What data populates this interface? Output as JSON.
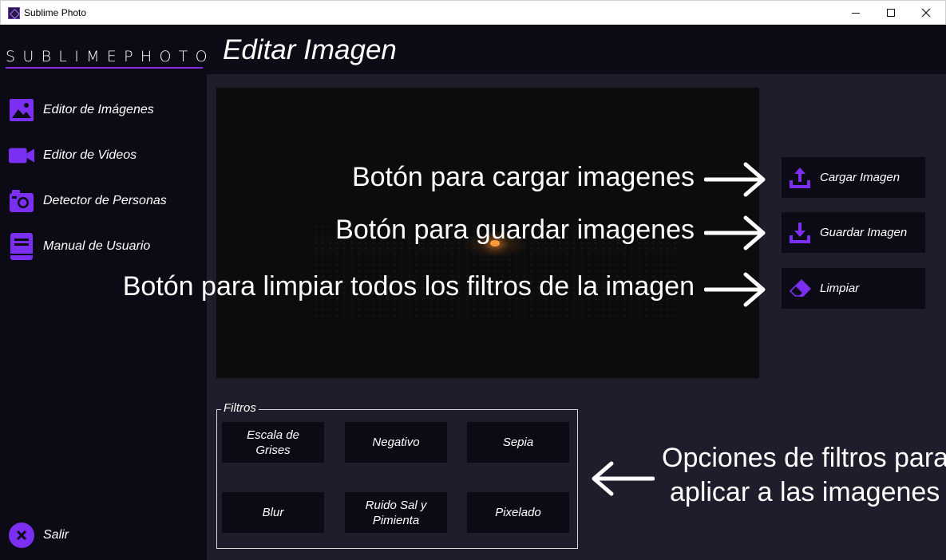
{
  "window": {
    "title": "Sublime Photo"
  },
  "sidebar": {
    "brand": "SUBLIMEPHOTO",
    "items": [
      {
        "label": "Editor de Imágenes",
        "icon": "image-icon"
      },
      {
        "label": "Editor de Videos",
        "icon": "video-camera-icon"
      },
      {
        "label": "Detector de Personas",
        "icon": "camera-icon"
      },
      {
        "label": "Manual de Usuario",
        "icon": "book-icon"
      }
    ],
    "exit_label": "Salir"
  },
  "header": {
    "title": "Editar Imagen"
  },
  "actions": {
    "load_label": "Cargar Imagen",
    "save_label": "Guardar Imagen",
    "clear_label": "Limpiar"
  },
  "annotations": {
    "load": "Botón para cargar imagenes",
    "save": "Botón para guardar imagenes",
    "clear": "Botón para limpiar todos los filtros de la imagen",
    "filters_line1": "Opciones de filtros para",
    "filters_line2": "aplicar a las imagenes"
  },
  "filters": {
    "legend": "Filtros",
    "buttons": [
      "Escala de Grises",
      "Negativo",
      "Sepia",
      "Blur",
      "Ruido Sal y Pimienta",
      "Pixelado"
    ]
  },
  "colors": {
    "accent": "#7b2ff2",
    "sidebar_bg": "#0c0a15",
    "main_bg": "#1f1d2b"
  }
}
